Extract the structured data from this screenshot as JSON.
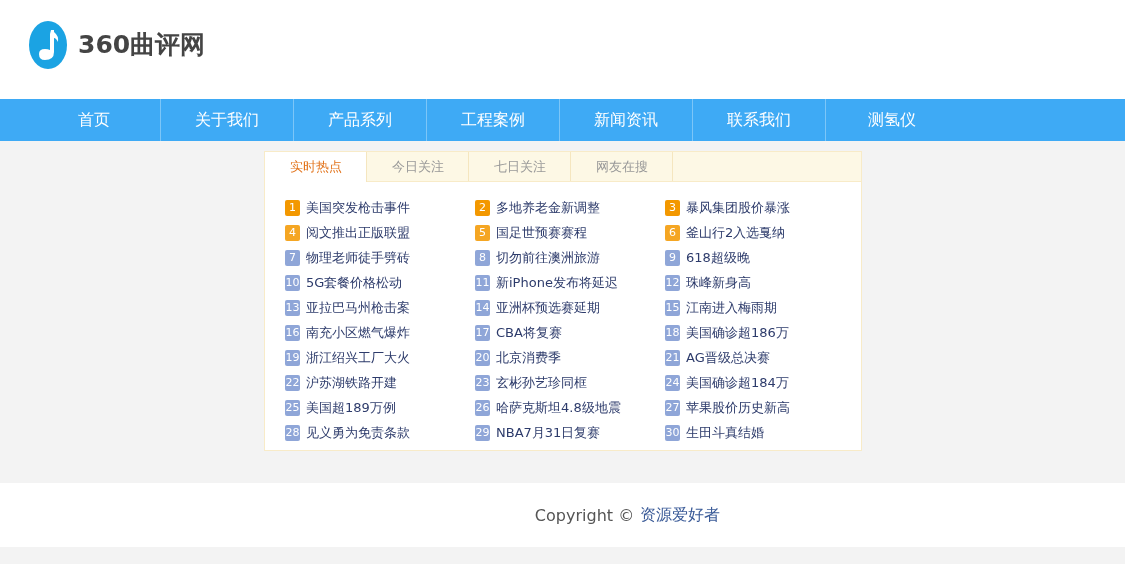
{
  "logo": {
    "text": "360曲评网"
  },
  "nav": [
    {
      "label": "首页"
    },
    {
      "label": "关于我们"
    },
    {
      "label": "产品系列"
    },
    {
      "label": "工程案例"
    },
    {
      "label": "新闻资讯"
    },
    {
      "label": "联系我们"
    },
    {
      "label": "测氢仪"
    }
  ],
  "tabs": [
    {
      "label": "实时热点",
      "selected": true
    },
    {
      "label": "今日关注",
      "selected": false
    },
    {
      "label": "七日关注",
      "selected": false
    },
    {
      "label": "网友在搜",
      "selected": false
    }
  ],
  "items": [
    {
      "rank": "1",
      "title": "美国突发枪击事件",
      "color": "#f39800"
    },
    {
      "rank": "2",
      "title": "多地养老金新调整",
      "color": "#f39800"
    },
    {
      "rank": "3",
      "title": "暴风集团股价暴涨",
      "color": "#f39800"
    },
    {
      "rank": "4",
      "title": "阅文推出正版联盟",
      "color": "#f5a623"
    },
    {
      "rank": "5",
      "title": "国足世预赛赛程",
      "color": "#f5a623"
    },
    {
      "rank": "6",
      "title": "釜山行2入选戛纳",
      "color": "#f5a623"
    },
    {
      "rank": "7",
      "title": "物理老师徒手劈砖",
      "color": "#8fa6d8"
    },
    {
      "rank": "8",
      "title": "切勿前往澳洲旅游",
      "color": "#8fa6d8"
    },
    {
      "rank": "9",
      "title": "618超级晚",
      "color": "#8fa6d8"
    },
    {
      "rank": "10",
      "title": "5G套餐价格松动",
      "color": "#8fa6d8"
    },
    {
      "rank": "11",
      "title": "新iPhone发布将延迟",
      "color": "#8fa6d8"
    },
    {
      "rank": "12",
      "title": "珠峰新身高",
      "color": "#8fa6d8"
    },
    {
      "rank": "13",
      "title": "亚拉巴马州枪击案",
      "color": "#8fa6d8"
    },
    {
      "rank": "14",
      "title": "亚洲杯预选赛延期",
      "color": "#8fa6d8"
    },
    {
      "rank": "15",
      "title": "江南进入梅雨期",
      "color": "#8fa6d8"
    },
    {
      "rank": "16",
      "title": "南充小区燃气爆炸",
      "color": "#8fa6d8"
    },
    {
      "rank": "17",
      "title": "CBA将复赛",
      "color": "#8fa6d8"
    },
    {
      "rank": "18",
      "title": "美国确诊超186万",
      "color": "#8fa6d8"
    },
    {
      "rank": "19",
      "title": "浙江绍兴工厂大火",
      "color": "#8fa6d8"
    },
    {
      "rank": "20",
      "title": "北京消费季",
      "color": "#8fa6d8"
    },
    {
      "rank": "21",
      "title": "AG晋级总决赛",
      "color": "#8fa6d8"
    },
    {
      "rank": "22",
      "title": "沪苏湖铁路开建",
      "color": "#8fa6d8"
    },
    {
      "rank": "23",
      "title": "玄彬孙艺珍同框",
      "color": "#8fa6d8"
    },
    {
      "rank": "24",
      "title": "美国确诊超184万",
      "color": "#8fa6d8"
    },
    {
      "rank": "25",
      "title": "美国超189万例",
      "color": "#8fa6d8"
    },
    {
      "rank": "26",
      "title": "哈萨克斯坦4.8级地震",
      "color": "#8fa6d8"
    },
    {
      "rank": "27",
      "title": "苹果股价历史新高",
      "color": "#8fa6d8"
    },
    {
      "rank": "28",
      "title": "见义勇为免责条款",
      "color": "#8fa6d8"
    },
    {
      "rank": "29",
      "title": "NBA7月31日复赛",
      "color": "#8fa6d8"
    },
    {
      "rank": "30",
      "title": "生田斗真结婚",
      "color": "#8fa6d8"
    }
  ],
  "footer": {
    "copyright": "Copyright ©",
    "link": "资源爱好者"
  }
}
